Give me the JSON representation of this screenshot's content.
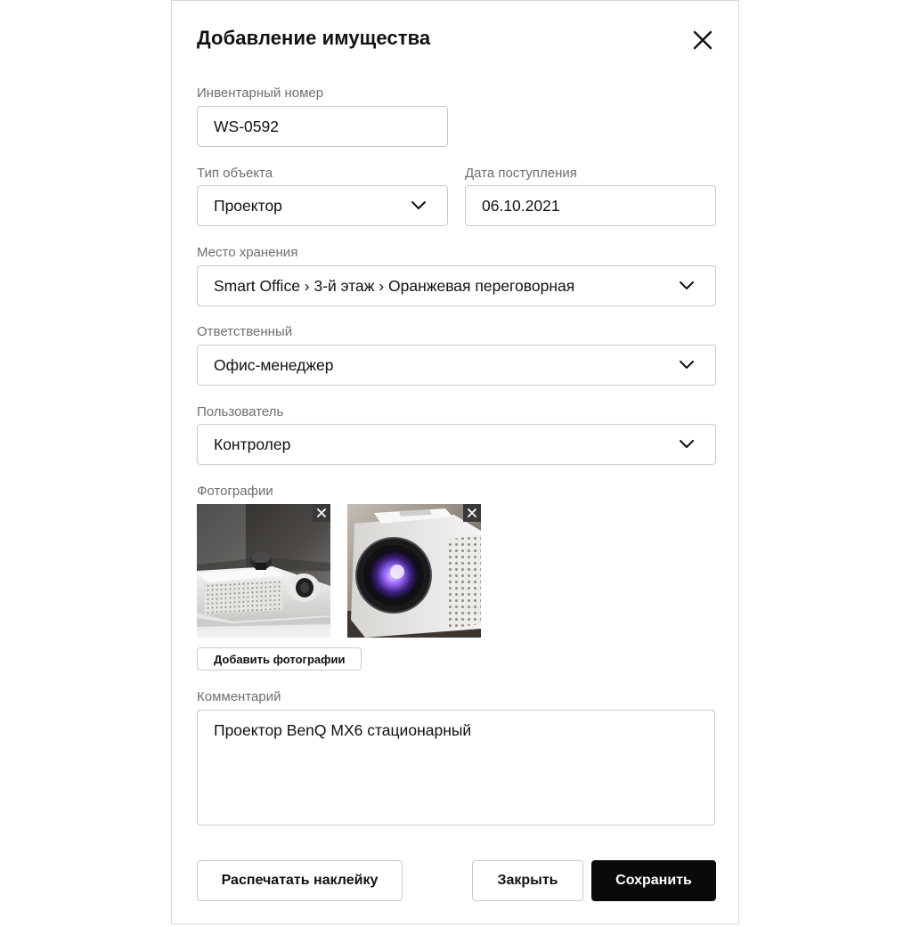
{
  "dialog": {
    "title": "Добавление имущества",
    "close_icon": "close-icon"
  },
  "fields": {
    "inventory_number": {
      "label": "Инвентарный номер",
      "value": "WS-0592"
    },
    "object_type": {
      "label": "Тип объекта",
      "value": "Проектор"
    },
    "arrival_date": {
      "label": "Дата поступления",
      "value": "06.10.2021"
    },
    "storage_location": {
      "label": "Место хранения",
      "value": "Smart Office › 3-й этаж › Оранжевая переговорная"
    },
    "responsible": {
      "label": "Ответственный",
      "value": "Офис-менеджер"
    },
    "user": {
      "label": "Пользователь",
      "value": "Контролер"
    }
  },
  "photos": {
    "label": "Фотографии",
    "items": [
      {
        "description_icon": "projector-photo-1"
      },
      {
        "description_icon": "projector-photo-2"
      }
    ],
    "add_button_label": "Добавить фотографии"
  },
  "comment": {
    "label": "Комментарий",
    "value": "Проектор BenQ MX6 стационарный"
  },
  "footer": {
    "print_label": "Распечатать наклейку",
    "close_label": "Закрыть",
    "save_label": "Сохранить"
  },
  "colors": {
    "primary": "#0a0a0a",
    "border": "#c9c9c9",
    "label": "#6e6e6e",
    "lens_glow": "#9b6bff"
  }
}
